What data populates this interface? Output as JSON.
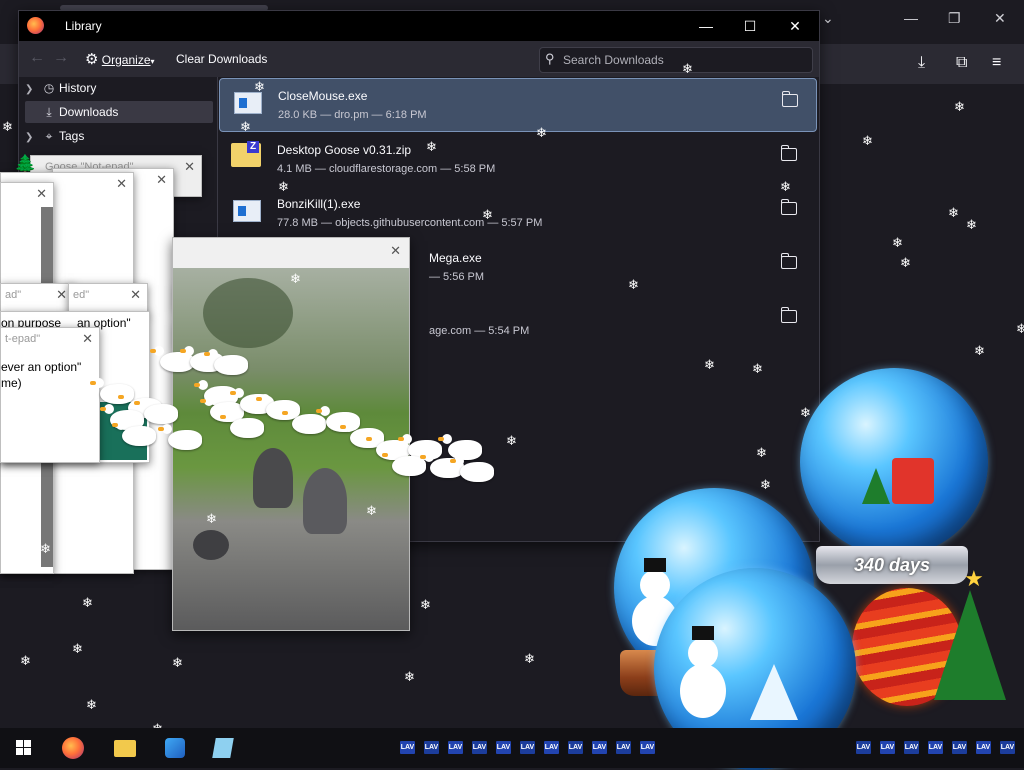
{
  "library": {
    "title": "Library",
    "organize_label": "Organize",
    "clear_downloads_label": "Clear Downloads",
    "search_placeholder": "Search Downloads",
    "sidebar": {
      "items": [
        {
          "label": "History",
          "icon": "clock-icon"
        },
        {
          "label": "Downloads",
          "icon": "download-icon"
        },
        {
          "label": "Tags",
          "icon": "tag-icon"
        }
      ]
    },
    "downloads": [
      {
        "name": "CloseMouse.exe",
        "meta": "28.0 KB — dro.pm — 6:18 PM",
        "icon": "exe-file-icon"
      },
      {
        "name": "Desktop Goose v0.31.zip",
        "meta": "4.1 MB — cloudflarestorage.com — 5:58 PM",
        "icon": "zip-file-icon"
      },
      {
        "name": "BonziKill(1).exe",
        "meta": "77.8 MB — objects.githubusercontent.com — 5:57 PM",
        "icon": "exe-file-icon"
      },
      {
        "name": "Mega.exe",
        "meta": "— 5:56 PM",
        "icon": "exe-file-icon"
      },
      {
        "name": "",
        "meta": "age.com — 5:54 PM",
        "icon": "exe-file-icon"
      }
    ]
  },
  "goose_windows": {
    "note_1": "Goose \"Not-epad\"",
    "fragment_1": "ad\"",
    "fragment_2": "ed\"",
    "fragment_3": "t-epad\"",
    "text_1": "on purpose",
    "text_2": "an option\"",
    "text_3": "ever an option\"",
    "text_4": "me)"
  },
  "globes": {
    "label": "340 days"
  },
  "taskbar": {
    "apps": [
      "firefox-icon",
      "file-explorer-icon",
      "app-icon",
      "notepad-icon"
    ],
    "tray_label": "LAV"
  },
  "colors": {
    "accent": "#415068",
    "background": "#1c1b22",
    "toolbar": "#2b2a33",
    "taskbar": "#101014"
  }
}
